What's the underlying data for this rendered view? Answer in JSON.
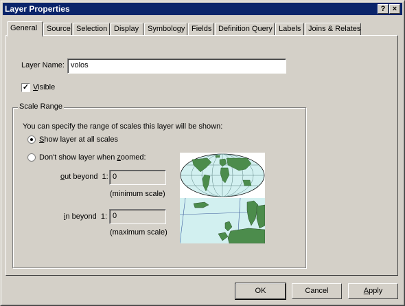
{
  "window": {
    "title": "Layer Properties",
    "help_btn": "?",
    "close_btn": "×"
  },
  "tabs": [
    {
      "label": "General"
    },
    {
      "label": "Source"
    },
    {
      "label": "Selection"
    },
    {
      "label": "Display"
    },
    {
      "label": "Symbology"
    },
    {
      "label": "Fields"
    },
    {
      "label": "Definition Query"
    },
    {
      "label": "Labels"
    },
    {
      "label": "Joins & Relates"
    }
  ],
  "general": {
    "layer_name_label": "Layer Name:",
    "layer_name_value": "volos",
    "visible_label": "Visible",
    "visible_checked": true
  },
  "scale_range": {
    "title": "Scale Range",
    "description": "You can specify the range of scales this layer will be shown:",
    "option_all": "Show layer at all scales",
    "option_zoomed": "Don't show layer when zoomed:",
    "selected": "all",
    "out_beyond_label": "out beyond  1:",
    "out_beyond_value": "0",
    "min_scale_note": "(minimum scale)",
    "in_beyond_label": "in beyond  1:",
    "in_beyond_value": "0",
    "max_scale_note": "(maximum scale)"
  },
  "buttons": {
    "ok": "OK",
    "cancel": "Cancel",
    "apply": "Apply"
  },
  "colors": {
    "title_bar": "#0a246a",
    "ocean": "#d2f0f0",
    "land": "#4c8c4c"
  }
}
